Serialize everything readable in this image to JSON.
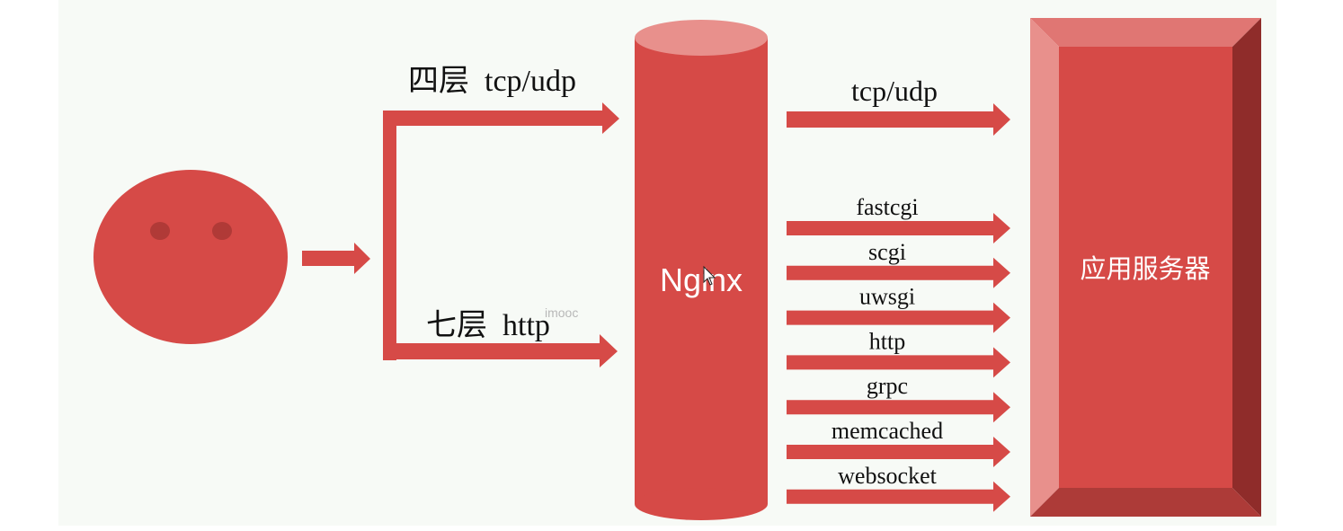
{
  "diagram": {
    "layer4_label": "四层  tcp/udp",
    "layer7_label": "七层  http",
    "watermark": "imooc",
    "proxy_label": "Nginx",
    "backend_top_label": "tcp/udp",
    "backend_protocols": [
      "fastcgi",
      "scgi",
      "uwsgi",
      "http",
      "grpc",
      "memcached",
      "websocket"
    ],
    "server_label": "应用服务器"
  },
  "colors": {
    "background": "#f7faf6",
    "red": "#d64a47",
    "red_light": "#e8908c",
    "red_dark": "#8f2c2a",
    "text": "#111111"
  }
}
